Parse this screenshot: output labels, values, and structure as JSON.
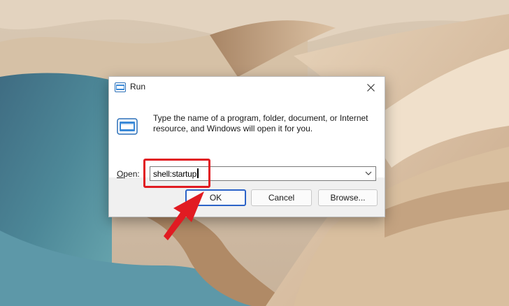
{
  "dialog": {
    "title": "Run",
    "description": "Type the name of a program, folder, document, or Internet resource, and Windows will open it for you.",
    "open_label_prefix": "",
    "open_label_hotkey": "O",
    "open_label_rest": "pen:",
    "open_value": "shell:startup",
    "ok_label": "OK",
    "cancel_label": "Cancel",
    "browse_label": "Browse..."
  },
  "colors": {
    "highlight": "#e11b22",
    "ok_border": "#2b63c8",
    "arrow": "#e11b22"
  },
  "icons": [
    "run-icon",
    "close-icon",
    "chevron-down-icon",
    "arrow-pointer"
  ]
}
